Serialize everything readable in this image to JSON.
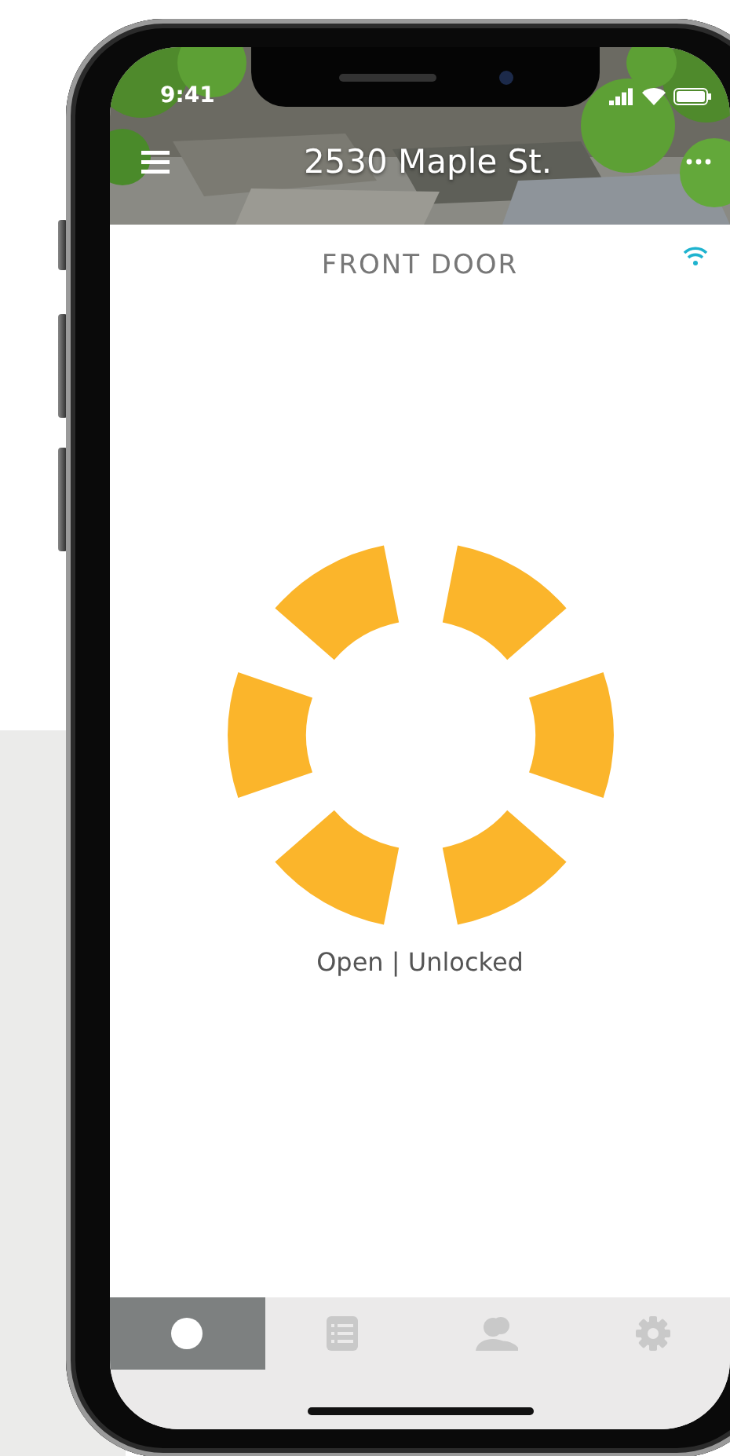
{
  "status_bar": {
    "time": "9:41"
  },
  "header": {
    "title": "2530 Maple St."
  },
  "device": {
    "name": "FRONT DOOR",
    "status": "Open | Unlocked"
  },
  "tabs": [
    {
      "kind": "lock",
      "selected": true
    },
    {
      "kind": "history",
      "selected": false
    },
    {
      "kind": "users",
      "selected": false
    },
    {
      "kind": "settings",
      "selected": false
    }
  ]
}
